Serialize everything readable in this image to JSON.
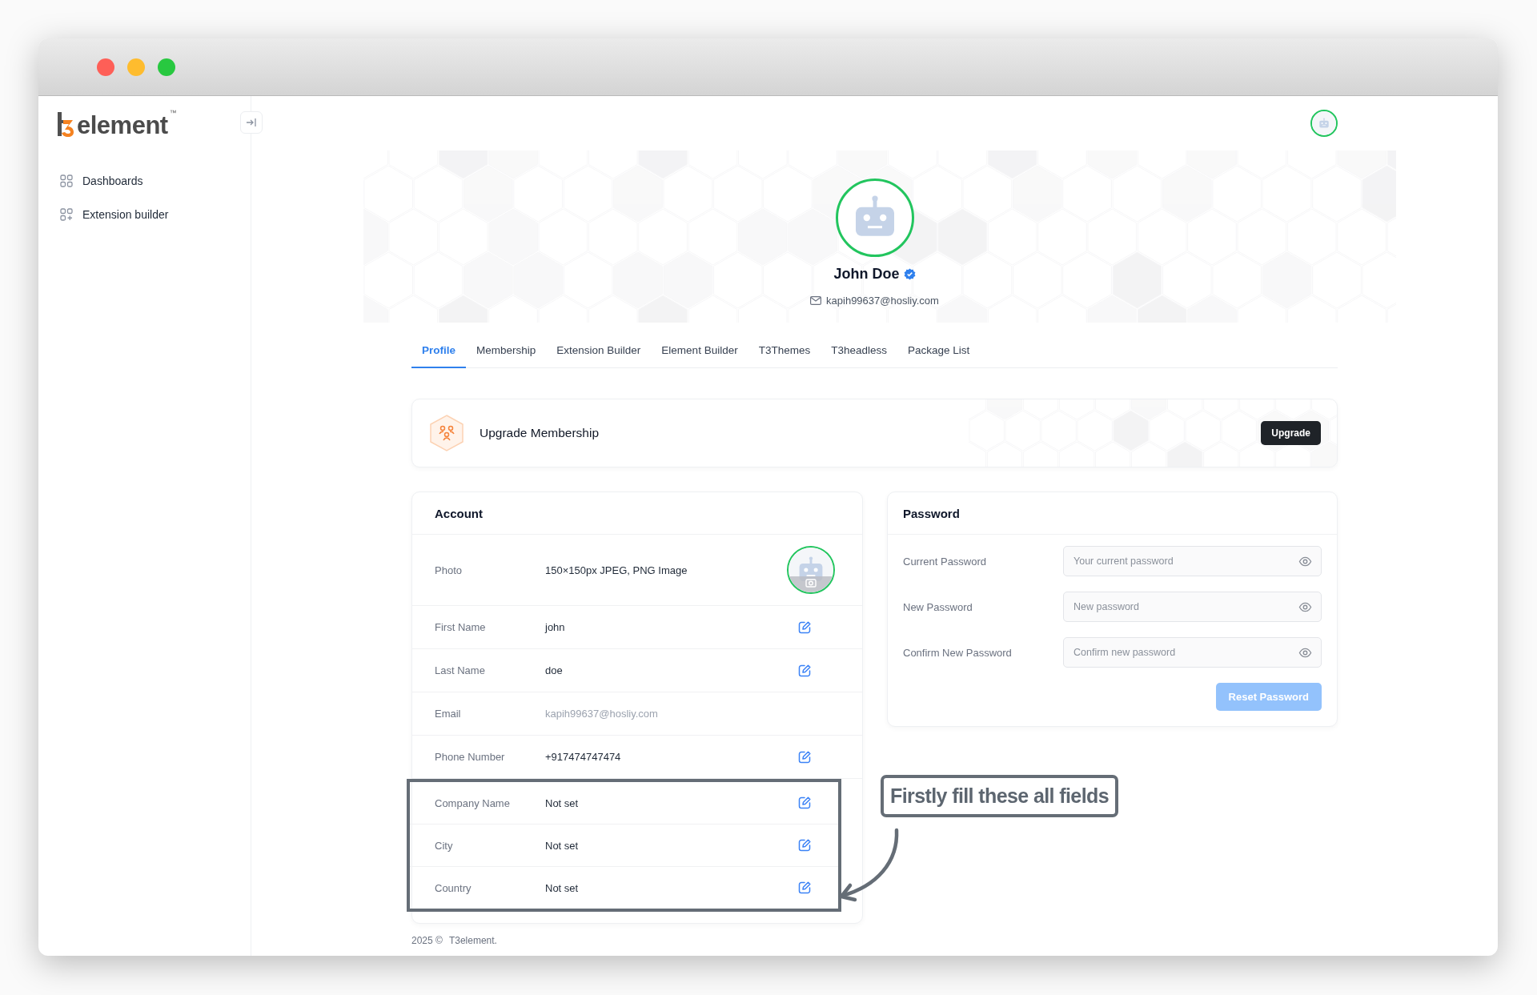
{
  "sidebar": {
    "logo": {
      "text": "element",
      "mark": "™"
    },
    "items": [
      {
        "label": "Dashboards",
        "kind": "grid"
      },
      {
        "label": "Extension builder",
        "kind": "grid-plus"
      }
    ]
  },
  "profile": {
    "name": "John Doe",
    "email": "kapih99637@hosliy.com"
  },
  "tabs": [
    {
      "label": "Profile",
      "selected": true
    },
    {
      "label": "Membership",
      "selected": false
    },
    {
      "label": "Extension Builder",
      "selected": false
    },
    {
      "label": "Element Builder",
      "selected": false
    },
    {
      "label": "T3Themes",
      "selected": false
    },
    {
      "label": "T3headless",
      "selected": false
    },
    {
      "label": "Package List",
      "selected": false
    }
  ],
  "upgrade": {
    "title": "Upgrade Membership",
    "button": "Upgrade"
  },
  "account": {
    "title": "Account",
    "photo": {
      "label": "Photo",
      "value": "150×150px JPEG, PNG Image"
    },
    "rows": [
      {
        "label": "First Name",
        "value": "john",
        "editable": true,
        "highlighted": false
      },
      {
        "label": "Last Name",
        "value": "doe",
        "editable": true,
        "highlighted": false
      },
      {
        "label": "Email",
        "value": "kapih99637@hosliy.com",
        "editable": false,
        "highlighted": false
      },
      {
        "label": "Phone Number",
        "value": "+917474747474",
        "editable": true,
        "highlighted": false
      },
      {
        "label": "Company Name",
        "value": "Not set",
        "editable": true,
        "highlighted": true
      },
      {
        "label": "City",
        "value": "Not set",
        "editable": true,
        "highlighted": true
      },
      {
        "label": "Country",
        "value": "Not set",
        "editable": true,
        "highlighted": true
      }
    ]
  },
  "password": {
    "title": "Password",
    "fields": [
      {
        "label": "Current Password",
        "placeholder": "Your current password"
      },
      {
        "label": "New Password",
        "placeholder": "New password"
      },
      {
        "label": "Confirm New Password",
        "placeholder": "Confirm new password"
      }
    ],
    "button": {
      "label": "Reset Password",
      "disabled": true
    }
  },
  "annotation": {
    "text": "Firstly fill these all fields"
  },
  "footer": {
    "year": "2025 ©",
    "brand": "T3element."
  }
}
